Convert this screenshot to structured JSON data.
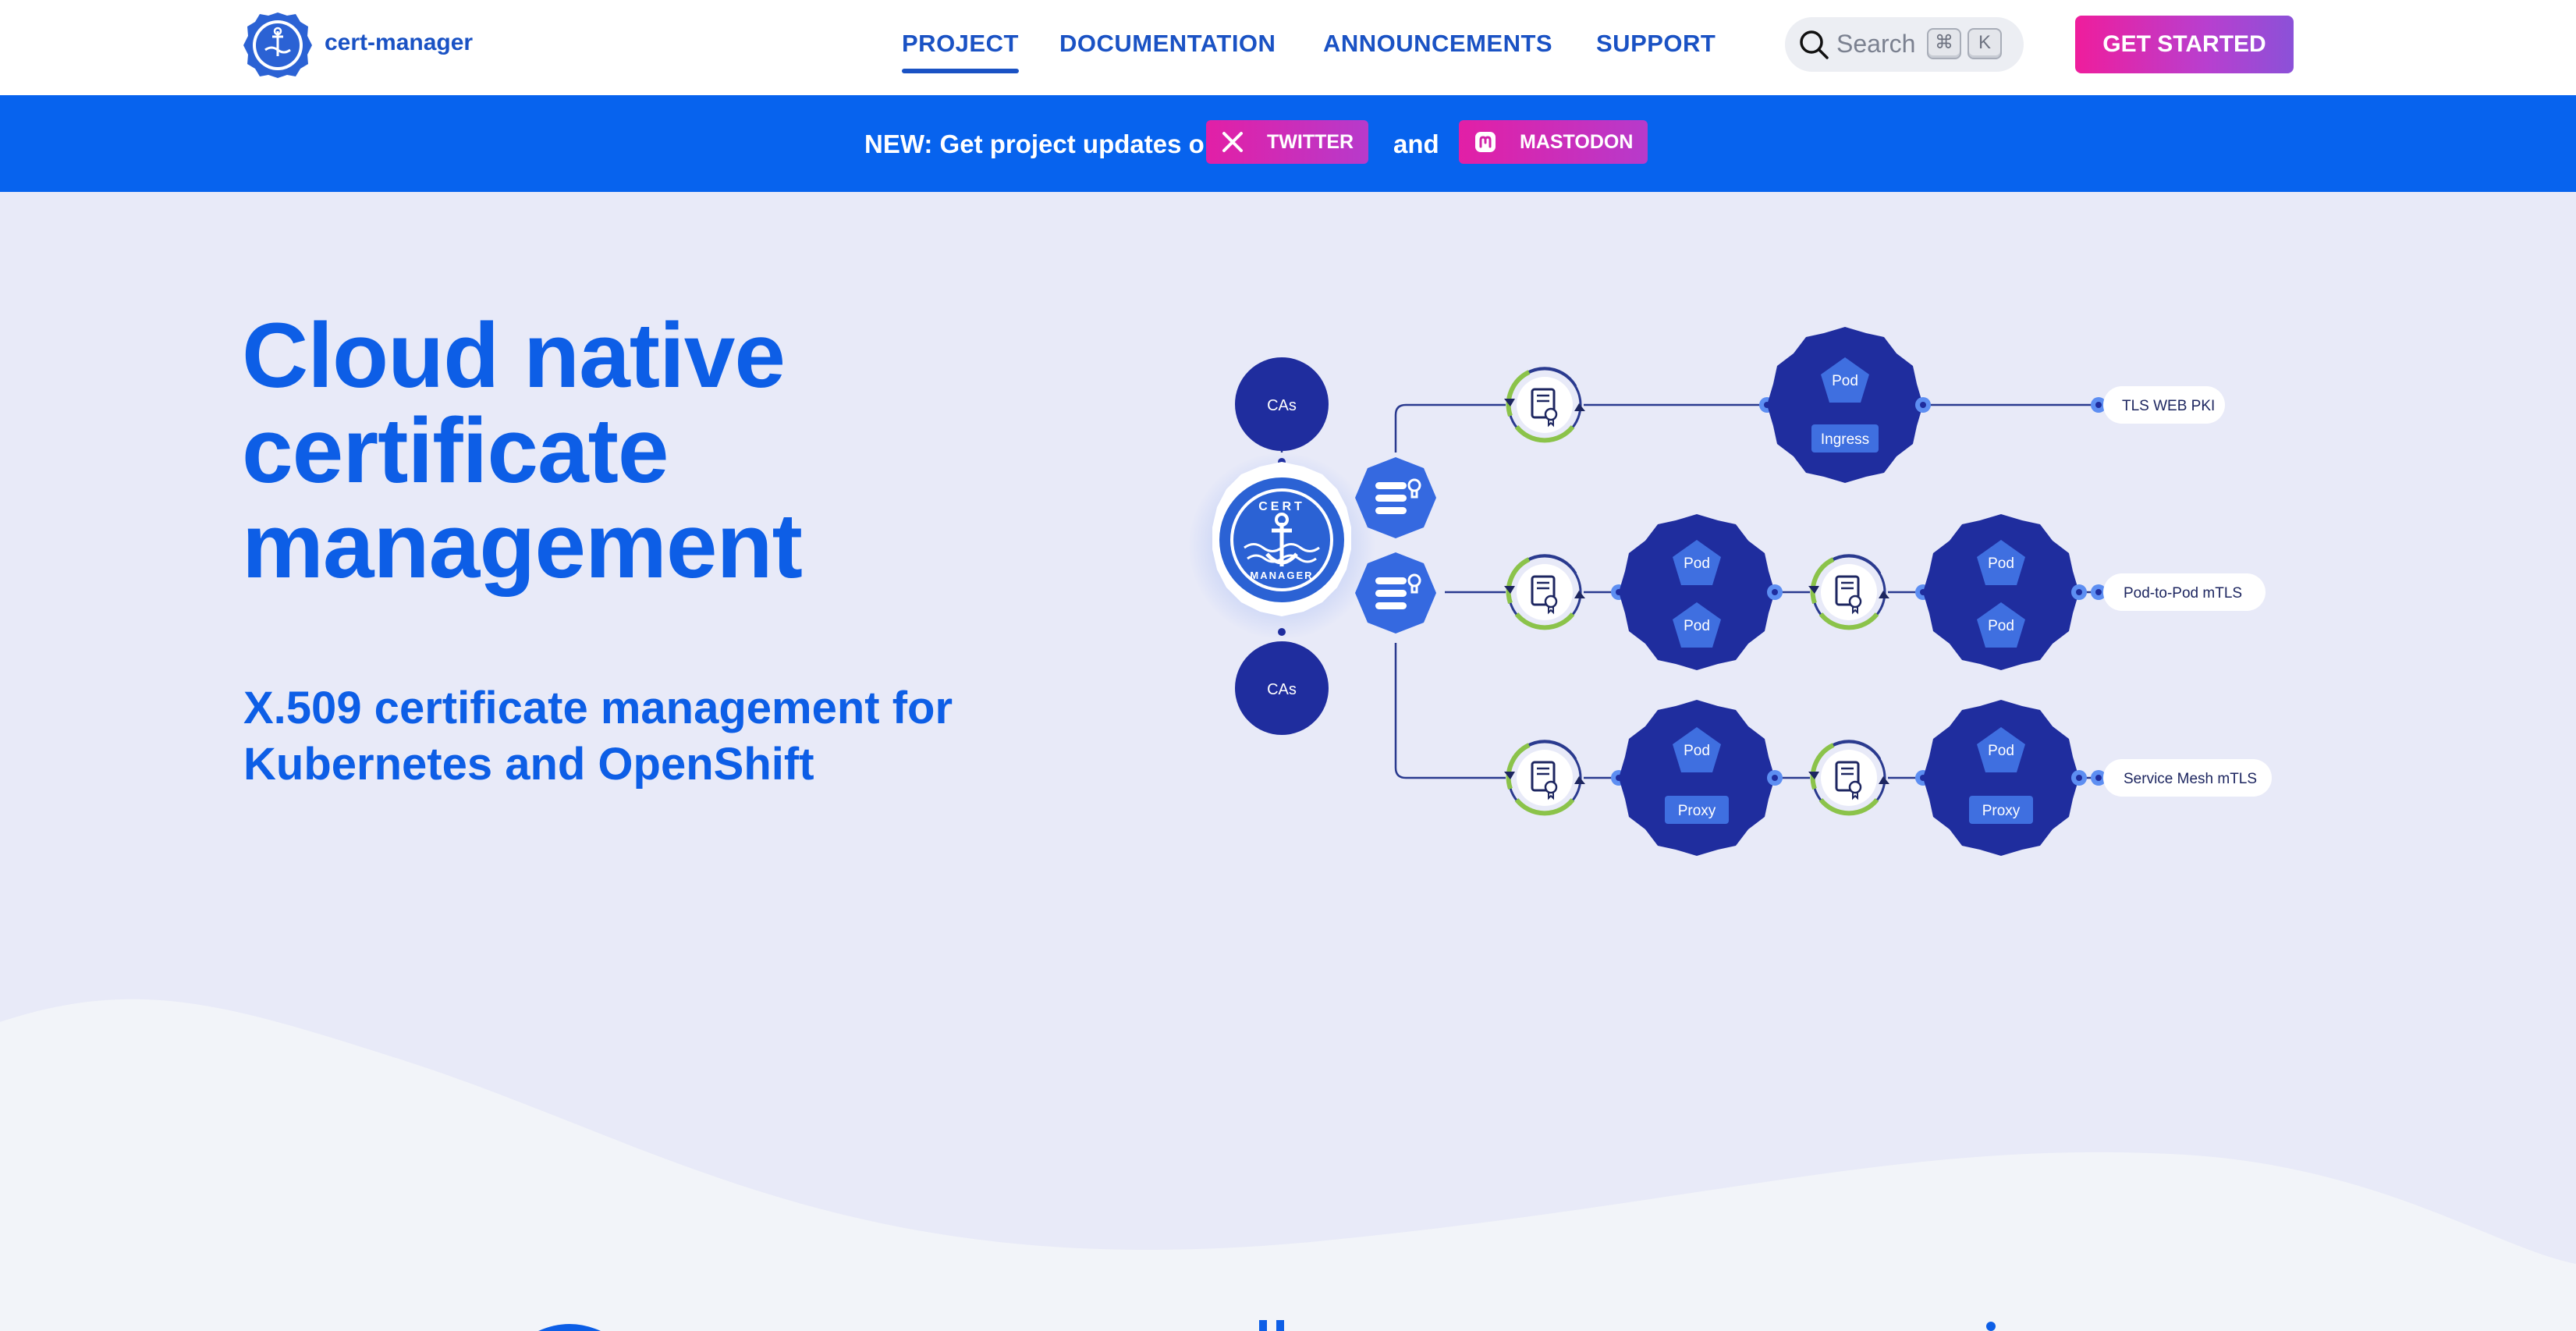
{
  "brand": {
    "name": "cert-manager",
    "logo": "cert-manager-logo-icon"
  },
  "nav": {
    "items": [
      {
        "label": "PROJECT",
        "active": true
      },
      {
        "label": "DOCUMENTATION",
        "active": false
      },
      {
        "label": "ANNOUNCEMENTS",
        "active": false
      },
      {
        "label": "SUPPORT",
        "active": false
      }
    ],
    "search": {
      "placeholder": "Search",
      "shortcut": [
        "⌘",
        "K"
      ]
    },
    "cta": "GET STARTED"
  },
  "banner": {
    "text": "NEW: Get project updates on",
    "twitter": "TWITTER",
    "and": "and",
    "mastodon": "MASTODON"
  },
  "hero": {
    "title_lines": [
      "Cloud native",
      "certificate",
      "management"
    ],
    "subtitle_lines": [
      "X.509 certificate management for",
      "Kubernetes and OpenShift"
    ]
  },
  "diagram": {
    "cas_top": "CAs",
    "cas_bottom": "CAs",
    "logo_text_top": "CERT",
    "logo_text_bottom": "MANAGER",
    "row1": {
      "pod": "Pod",
      "tag": "Ingress",
      "label": "TLS WEB PKI"
    },
    "row2": {
      "pods": [
        "Pod",
        "Pod",
        "Pod",
        "Pod"
      ],
      "label": "Pod-to-Pod mTLS"
    },
    "row3": {
      "pods": [
        "Pod",
        "Pod"
      ],
      "tags": [
        "Proxy",
        "Proxy"
      ],
      "label": "Service Mesh mTLS"
    }
  },
  "colors": {
    "primary": "#0d5ee6",
    "banner": "#0763ee",
    "hero_bg": "#e8eaf8",
    "pod": "#1f2d9e",
    "accent_gradient_start": "#ef1d9c",
    "accent_gradient_end": "#8b51d8",
    "cert_ring": "#8bc34a"
  }
}
